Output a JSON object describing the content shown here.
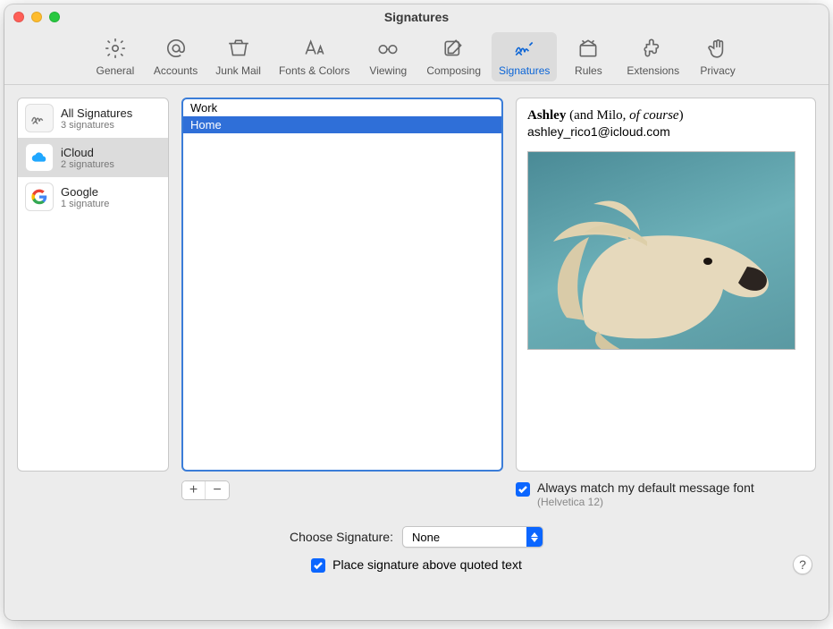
{
  "window": {
    "title": "Signatures"
  },
  "toolbar": {
    "items": [
      {
        "label": "General"
      },
      {
        "label": "Accounts"
      },
      {
        "label": "Junk Mail"
      },
      {
        "label": "Fonts & Colors"
      },
      {
        "label": "Viewing"
      },
      {
        "label": "Composing"
      },
      {
        "label": "Signatures",
        "selected": true
      },
      {
        "label": "Rules"
      },
      {
        "label": "Extensions"
      },
      {
        "label": "Privacy"
      }
    ]
  },
  "accounts": [
    {
      "name": "All Signatures",
      "sub": "3 signatures"
    },
    {
      "name": "iCloud",
      "sub": "2 signatures",
      "selected": true
    },
    {
      "name": "Google",
      "sub": "1 signature"
    }
  ],
  "signatures": [
    {
      "name": "Work"
    },
    {
      "name": "Home",
      "selected": true
    }
  ],
  "preview": {
    "name_bold": "Ashley",
    "name_rest1": " (and Milo, ",
    "name_italic": "of course",
    "name_rest2": ")",
    "email": "ashley_rico1@icloud.com"
  },
  "buttons": {
    "add": "+",
    "remove": "−"
  },
  "matchfont": {
    "label": "Always match my default message font",
    "sub": "(Helvetica 12)",
    "checked": true
  },
  "choose": {
    "label": "Choose Signature:",
    "value": "None"
  },
  "place_above": {
    "label": "Place signature above quoted text",
    "checked": true
  },
  "help": "?"
}
